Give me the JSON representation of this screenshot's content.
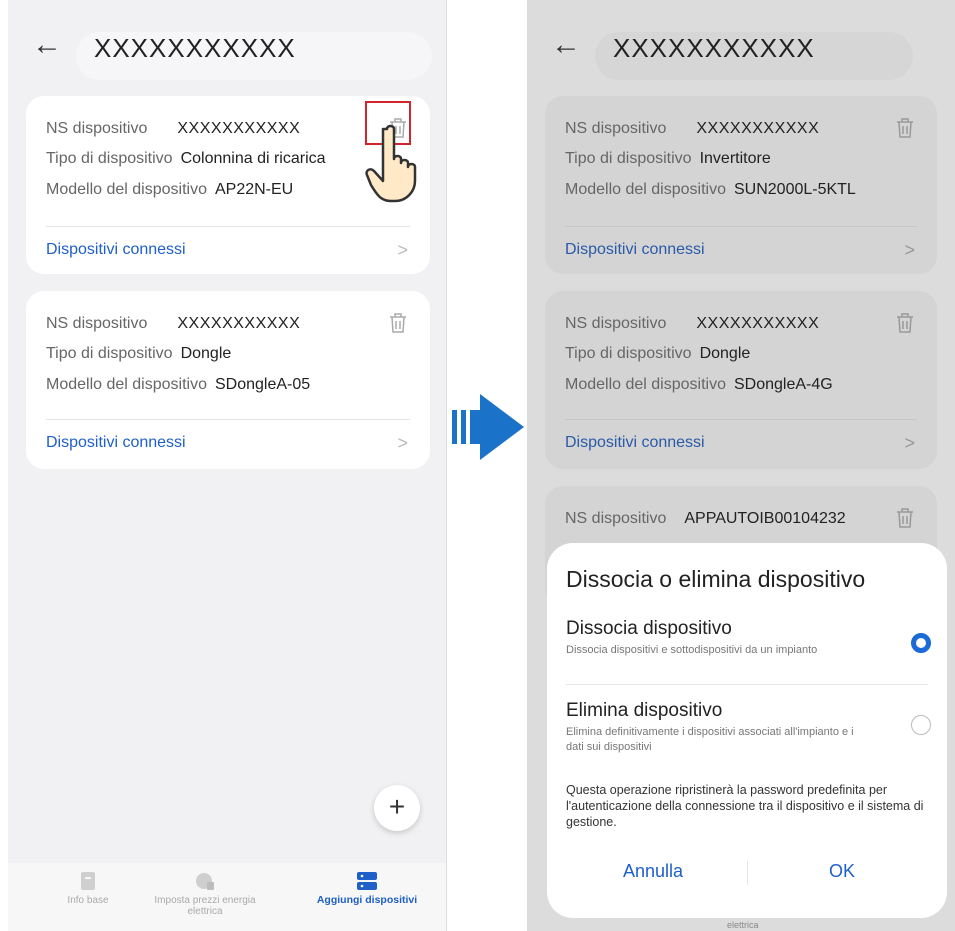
{
  "left": {
    "back_glyph": "←",
    "title": "XXXXXXXXXXX",
    "cards": [
      {
        "sn_label": "NS dispositivo",
        "sn_value": "XXXXXXXXXXX",
        "type_label": "Tipo di dispositivo",
        "type_value": "Colonnina di ricarica",
        "model_label": "Modello del dispositivo",
        "model_value": "AP22N-EU",
        "link": "Dispositivi connessi"
      },
      {
        "sn_label": "NS dispositivo",
        "sn_value": "XXXXXXXXXXX",
        "type_label": "Tipo di dispositivo",
        "type_value": "Dongle",
        "model_label": "Modello del dispositivo",
        "model_value": "SDongleA-05",
        "link": "Dispositivi connessi"
      }
    ],
    "fab_label": "+",
    "tabs": [
      {
        "label": "Info base",
        "icon": "document-icon"
      },
      {
        "label": "Imposta prezzi energia elettrica",
        "icon": "price-icon"
      },
      {
        "label": "Aggiungi dispositivi",
        "icon": "devices-icon"
      }
    ]
  },
  "right": {
    "back_glyph": "←",
    "title": "XXXXXXXXXXX",
    "cards": [
      {
        "sn_label": "NS dispositivo",
        "sn_value": "XXXXXXXXXXX",
        "type_label": "Tipo di dispositivo",
        "type_value": "Invertitore",
        "model_label": "Modello del dispositivo",
        "model_value": "SUN2000L-5KTL",
        "link": "Dispositivi connessi"
      },
      {
        "sn_label": "NS dispositivo",
        "sn_value": "XXXXXXXXXXX",
        "type_label": "Tipo di dispositivo",
        "type_value": "Dongle",
        "model_label": "Modello del dispositivo",
        "model_value": "SDongleA-4G",
        "link": "Dispositivi connessi"
      },
      {
        "sn_label": "NS dispositivo",
        "sn_value": "APPAUTOIB00104232"
      }
    ],
    "dialog": {
      "title": "Dissocia o elimina dispositivo",
      "option1_title": "Dissocia dispositivo",
      "option1_desc": "Dissocia dispositivi e sottodispositivi da un impianto",
      "option2_title": "Elimina dispositivo",
      "option2_desc": "Elimina definitivamente i dispositivi associati all'impianto e i dati sui dispositivi",
      "note": "Questa operazione ripristinerà la password predefinita per l'autenticazione della connessione tra il dispositivo e il sistema di gestione.",
      "cancel": "Annulla",
      "ok": "OK",
      "selected_option": "Dissocia dispositivo"
    },
    "tab_fragment": "elettrica"
  },
  "colors": {
    "accent": "#1e5fc8",
    "highlight": "#d2252b",
    "arrow": "#1a73c9"
  }
}
